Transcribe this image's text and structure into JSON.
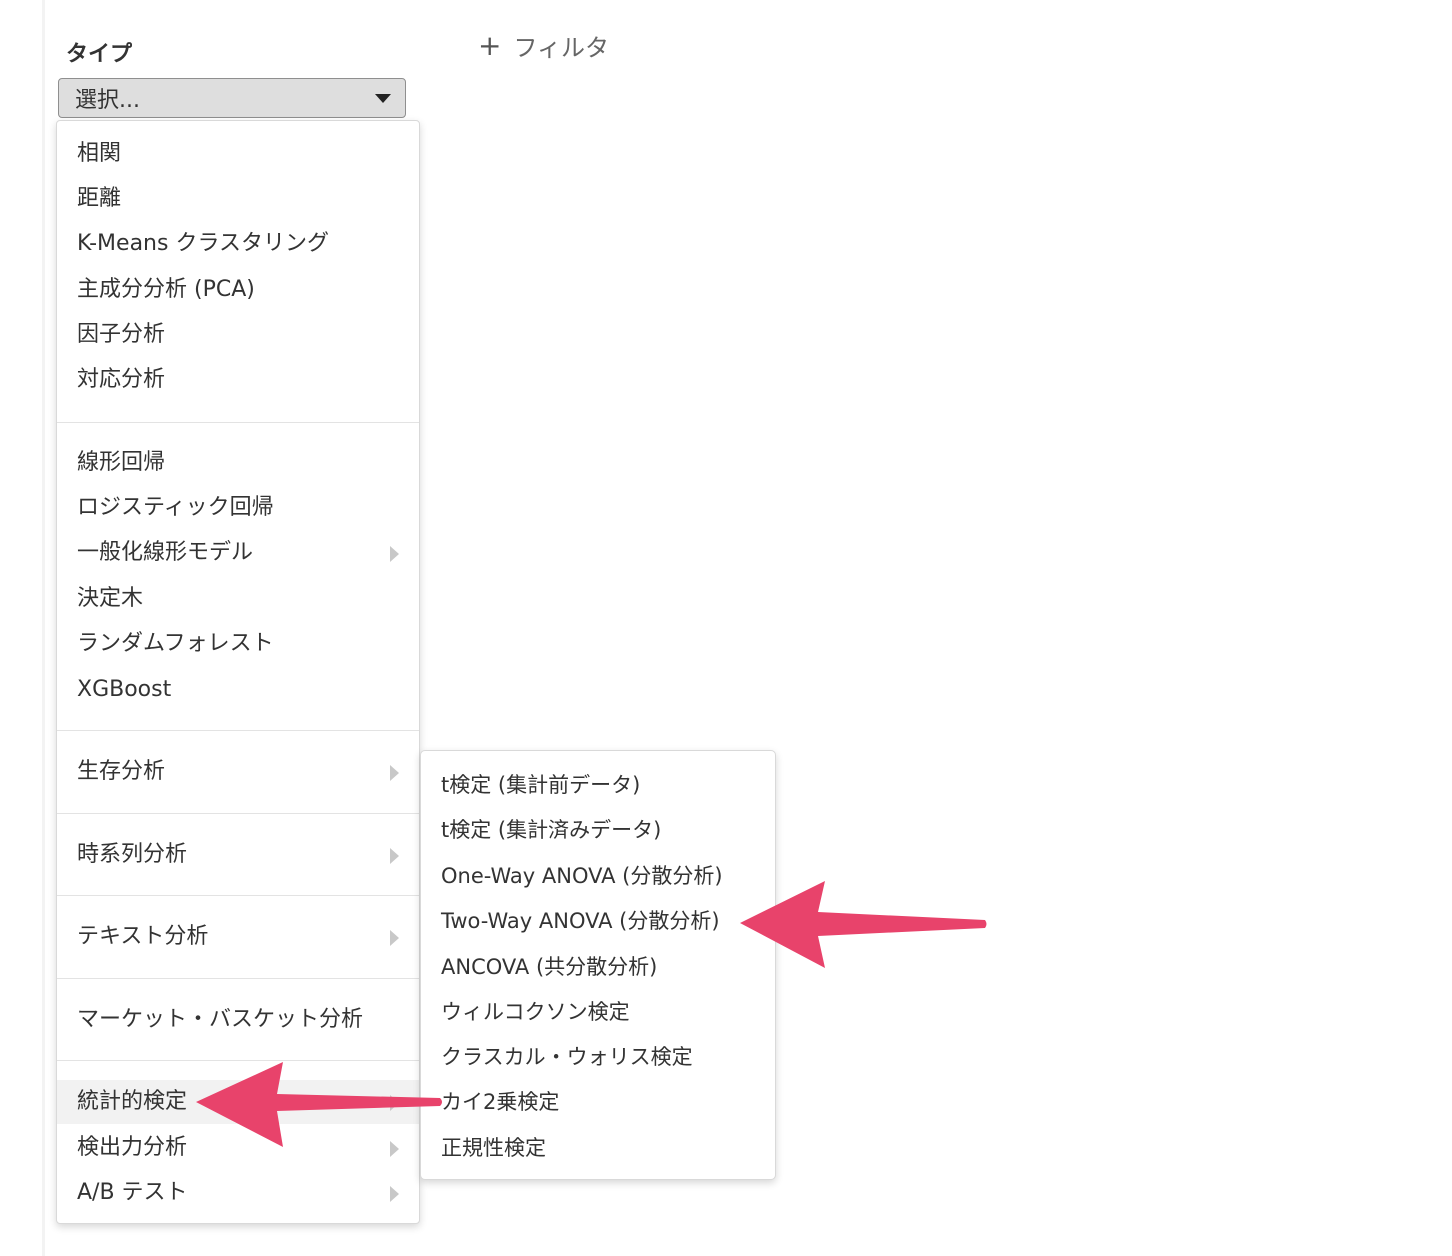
{
  "header": {
    "type_label": "タイプ",
    "filter_plus": "+",
    "filter_label": "フィルタ"
  },
  "select": {
    "value": "選択..."
  },
  "menu": {
    "items": [
      {
        "label": "相関",
        "submenu": false
      },
      {
        "label": "距離",
        "submenu": false
      },
      {
        "label": "K-Means クラスタリング",
        "submenu": false
      },
      {
        "label": "主成分分析 (PCA)",
        "submenu": false
      },
      {
        "label": "因子分析",
        "submenu": false
      },
      {
        "label": "対応分析",
        "submenu": false
      },
      {
        "label": "線形回帰",
        "submenu": false
      },
      {
        "label": "ロジスティック回帰",
        "submenu": false
      },
      {
        "label": "一般化線形モデル",
        "submenu": true
      },
      {
        "label": "決定木",
        "submenu": false
      },
      {
        "label": "ランダムフォレスト",
        "submenu": false
      },
      {
        "label": "XGBoost",
        "submenu": false
      },
      {
        "label": "生存分析",
        "submenu": true
      },
      {
        "label": "時系列分析",
        "submenu": true
      },
      {
        "label": "テキスト分析",
        "submenu": true
      },
      {
        "label": "マーケット・バスケット分析",
        "submenu": false
      },
      {
        "label": "統計的検定",
        "submenu": true,
        "active": true
      },
      {
        "label": "検出力分析",
        "submenu": true
      },
      {
        "label": "A/B テスト",
        "submenu": true
      }
    ]
  },
  "submenu": {
    "items": [
      {
        "label": "t検定 (集計前データ)"
      },
      {
        "label": "t検定 (集計済みデータ)"
      },
      {
        "label": "One-Way ANOVA (分散分析)"
      },
      {
        "label": "Two-Way ANOVA (分散分析)"
      },
      {
        "label": "ANCOVA (共分散分析)"
      },
      {
        "label": "ウィルコクソン検定"
      },
      {
        "label": "クラスカル・ウォリス検定"
      },
      {
        "label": "カイ2乗検定"
      },
      {
        "label": "正規性検定"
      }
    ]
  },
  "colors": {
    "arrow": "#e8436b",
    "active_bg": "#f2f2f2"
  }
}
